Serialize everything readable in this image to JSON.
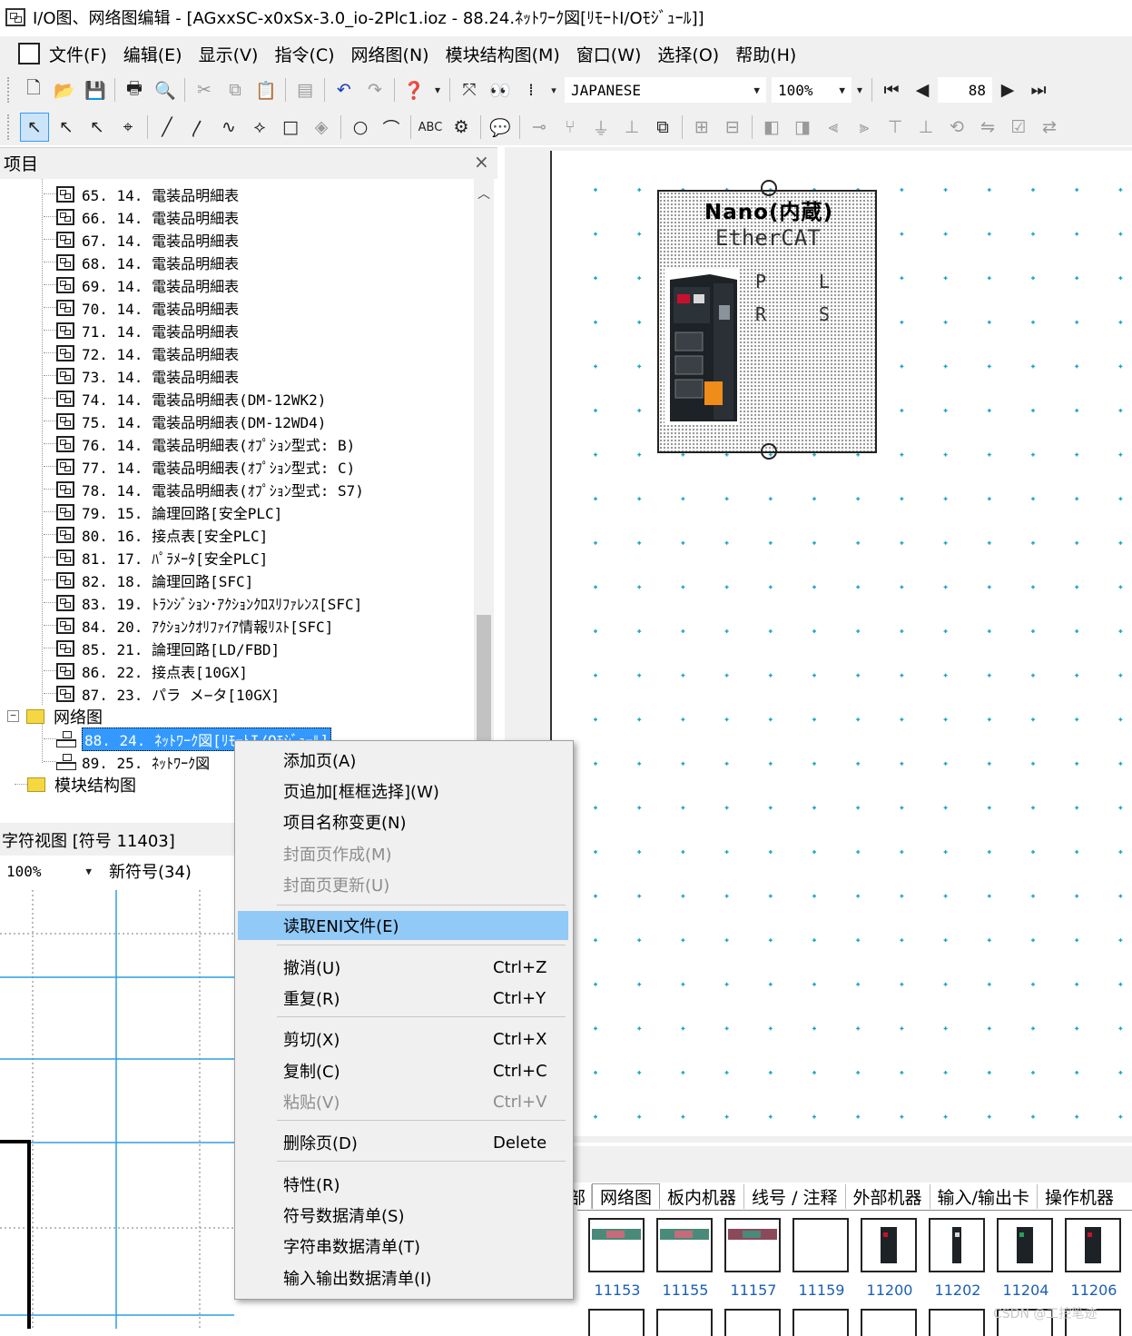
{
  "window": {
    "title": "I/O图、网络图编辑 - [AGxxSC-x0xSx-3.0_io-2Plc1.ioz - 88.24.ﾈｯﾄﾜｰｸ図[ﾘﾓｰﾄI/Oﾓｼﾞｭｰﾙ]]"
  },
  "menubar": {
    "items": [
      "文件(F)",
      "编辑(E)",
      "显示(V)",
      "指令(C)",
      "网络图(N)",
      "模块结构图(M)",
      "窗口(W)",
      "选择(O)",
      "帮助(H)"
    ]
  },
  "toolbar": {
    "language": "JAPANESE",
    "zoom": "100%",
    "page_number": "88"
  },
  "project_pane": {
    "title": "项目",
    "close_glyph": "×",
    "tree_items": [
      "65. 14. 電装品明細表",
      "66. 14. 電装品明細表",
      "67. 14. 電装品明細表",
      "68. 14. 電装品明細表",
      "69. 14. 電装品明細表",
      "70. 14. 電装品明細表",
      "71. 14. 電装品明細表",
      "72. 14. 電装品明細表",
      "73. 14. 電装品明細表",
      "74. 14. 電装品明細表(DM-12WK2)",
      "75. 14. 電装品明細表(DM-12WD4)",
      "76. 14. 電装品明細表(ｵﾌﾟｼｮﾝ型式: B)",
      "77. 14. 電装品明細表(ｵﾌﾟｼｮﾝ型式: C)",
      "78. 14. 電装品明細表(ｵﾌﾟｼｮﾝ型式: S7)",
      "79. 15. 論理回路[安全PLC]",
      "80. 16. 接点表[安全PLC]",
      "81. 17. ﾊﾟﾗﾒｰﾀ[安全PLC]",
      "82. 18. 論理回路[SFC]",
      "83. 19. ﾄﾗﾝｼﾞｼｮﾝ･ｱｸｼｮﾝｸﾛｽﾘﾌｧﾚﾝｽ[SFC]",
      "84. 20. ｱｸｼｮﾝｸｵﾘﾌｧｲｱ情報ﾘｽﾄ[SFC]",
      "85. 21. 論理回路[LD/FBD]",
      "86. 22. 接点表[10GX]",
      "87. 23. パラ メ−タ[10GX]"
    ],
    "folder_network": "网络图",
    "network_items": [
      "88. 24. ﾈｯﾄﾜｰｸ図[ﾘﾓｰﾄI/Oﾓｼﾞｭｰﾙ]",
      "89. 25. ﾈｯﾄﾜｰｸ図"
    ],
    "folder_module": "模块结构图"
  },
  "char_view": {
    "title": "字符视图 [符号 11403]",
    "zoom": "100%",
    "new_symbol": "新符号(34)"
  },
  "node": {
    "title": "Nano(内蔵)",
    "subtitle": "EtherCAT",
    "pins": [
      "P",
      "L",
      "R",
      "S"
    ]
  },
  "palette": {
    "tabs": [
      "部",
      "网络图",
      "板内机器",
      "线号 / 注释",
      "外部机器",
      "输入/输出卡",
      "操作机器"
    ],
    "items": [
      "11153",
      "11155",
      "11157",
      "11159",
      "11200",
      "11202",
      "11204",
      "11206"
    ]
  },
  "context_menu": {
    "items": [
      {
        "label": "添加页(A)",
        "shortcut": "",
        "state": "normal"
      },
      {
        "label": "页追加[框框选择](W)",
        "shortcut": "",
        "state": "normal"
      },
      {
        "label": "项目名称变更(N)",
        "shortcut": "",
        "state": "normal"
      },
      {
        "label": "封面页作成(M)",
        "shortcut": "",
        "state": "disabled"
      },
      {
        "label": "封面页更新(U)",
        "shortcut": "",
        "state": "disabled"
      },
      {
        "label": "读取ENI文件(E)",
        "shortcut": "",
        "state": "highlighted"
      },
      {
        "label": "撤消(U)",
        "shortcut": "Ctrl+Z",
        "state": "normal"
      },
      {
        "label": "重复(R)",
        "shortcut": "Ctrl+Y",
        "state": "normal"
      },
      {
        "label": "剪切(X)",
        "shortcut": "Ctrl+X",
        "state": "normal"
      },
      {
        "label": "复制(C)",
        "shortcut": "Ctrl+C",
        "state": "normal"
      },
      {
        "label": "粘贴(V)",
        "shortcut": "Ctrl+V",
        "state": "disabled"
      },
      {
        "label": "删除页(D)",
        "shortcut": "Delete",
        "state": "normal"
      },
      {
        "label": "特性(R)",
        "shortcut": "",
        "state": "normal"
      },
      {
        "label": "符号数据清单(S)",
        "shortcut": "",
        "state": "normal"
      },
      {
        "label": "字符串数据清单(T)",
        "shortcut": "",
        "state": "normal"
      },
      {
        "label": "输入输出数据清单(I)",
        "shortcut": "",
        "state": "normal"
      }
    ]
  },
  "watermark": "CSDN @工控笔迹",
  "colors": {
    "highlight": "#91c9f7",
    "tree_selection": "#3399ff",
    "grid_dot": "#1aa3c4",
    "chrome": "#f0f0f0"
  }
}
